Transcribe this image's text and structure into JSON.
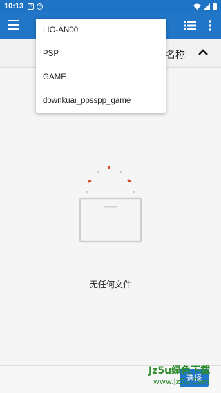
{
  "status_bar": {
    "time": "10:13",
    "icons": [
      "notification-a-icon",
      "notification-circle-icon",
      "wifi-icon",
      "signal-icon",
      "battery-icon"
    ]
  },
  "app_bar": {
    "color": "#2176c7",
    "icons": [
      "hamburger-menu-icon",
      "list-view-icon",
      "more-vert-icon"
    ]
  },
  "popup_menu": {
    "items": [
      "LIO-AN00",
      "PSP",
      "GAME",
      "downkuai_ppsspp_game"
    ]
  },
  "sort_bar": {
    "label": "名称",
    "icon": "chevron-up-icon"
  },
  "empty_state": {
    "message": "无任何文件",
    "accent": "#d94a2b"
  },
  "bottom": {
    "select_button_label": "选择",
    "watermark_text": "Jz5u绿色下载",
    "watermark_url": "www.Jz5u.Com"
  }
}
